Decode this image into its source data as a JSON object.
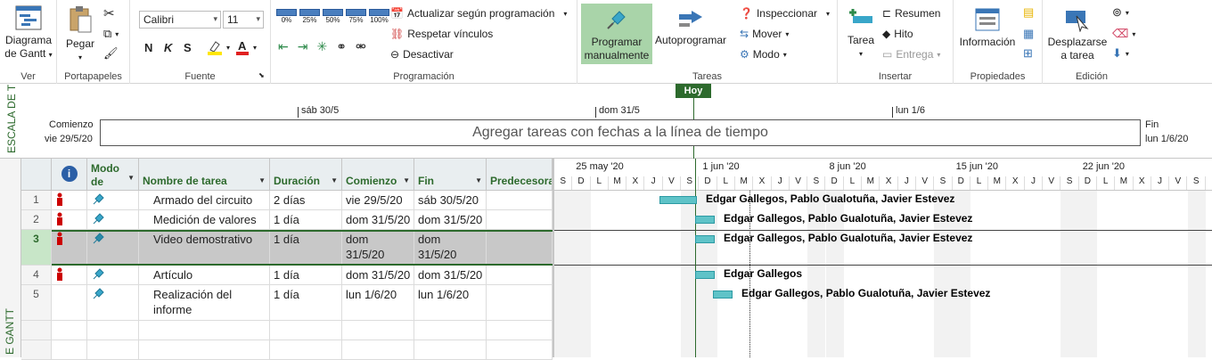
{
  "ribbon": {
    "ver": {
      "label": "Ver",
      "gantt_line1": "Diagrama",
      "gantt_line2": "de Gantt"
    },
    "portapapeles": {
      "label": "Portapapeles",
      "pegar": "Pegar"
    },
    "fuente": {
      "label": "Fuente",
      "font": "Calibri",
      "size": "11",
      "bold": "N",
      "italic": "K",
      "underline": "S"
    },
    "programacion": {
      "label": "Programación",
      "pcts": [
        "0%",
        "25%",
        "50%",
        "75%",
        "100%"
      ],
      "actualizar": "Actualizar según programación",
      "respetar": "Respetar vínculos",
      "desactivar": "Desactivar"
    },
    "tareas": {
      "label": "Tareas",
      "prog_line1": "Programar",
      "prog_line2": "manualmente",
      "auto": "Autoprogramar",
      "inspeccionar": "Inspeccionar",
      "mover": "Mover",
      "modo": "Modo"
    },
    "insertar": {
      "label": "Insertar",
      "tarea": "Tarea",
      "resumen": "Resumen",
      "hito": "Hito",
      "entrega": "Entrega"
    },
    "propiedades": {
      "label": "Propiedades",
      "informacion": "Información"
    },
    "edicion": {
      "label": "Edición",
      "desp_line1": "Desplazarse",
      "desp_line2": "a tarea"
    }
  },
  "timeline": {
    "side_label": "ESCALA DE T",
    "hoy": "Hoy",
    "start_label": "Comienzo",
    "start_date": "vie 29/5/20",
    "end_label": "Fin",
    "end_date": "lun 1/6/20",
    "marks": [
      "sáb 30/5",
      "dom 31/5",
      "lun 1/6"
    ],
    "placeholder": "Agregar tareas con fechas a la línea de tiempo"
  },
  "table": {
    "side_label": "E GANTT",
    "headers": {
      "info": "i",
      "mode_line1": "Modo",
      "mode_line2": "de",
      "name": "Nombre de tarea",
      "duration": "Duración",
      "start": "Comienzo",
      "end": "Fin",
      "pred": "Predecesoras"
    },
    "rows": [
      {
        "id": "1",
        "name": "Armado del circuito",
        "duration": "2 días",
        "start": "vie 29/5/20",
        "end": "sáb 30/5/20"
      },
      {
        "id": "2",
        "name": "Medición de valores",
        "duration": "1 día",
        "start": "dom 31/5/20",
        "end": "dom 31/5/20"
      },
      {
        "id": "3",
        "name": "Video demostrativo",
        "duration": "1 día",
        "start": "dom 31/5/20",
        "end": "dom 31/5/20"
      },
      {
        "id": "4",
        "name": "Artículo",
        "duration": "1 día",
        "start": "dom 31/5/20",
        "end": "dom 31/5/20"
      },
      {
        "id": "5",
        "name": "Realización del informe",
        "duration": "1 día",
        "start": "lun 1/6/20",
        "end": "lun 1/6/20"
      }
    ]
  },
  "gantt": {
    "weeks": [
      "25 may '20",
      "1 jun '20",
      "8 jun '20",
      "15 jun '20",
      "22 jun '20"
    ],
    "days": [
      "S",
      "D",
      "L",
      "M",
      "X",
      "J",
      "V",
      "S",
      "D",
      "L",
      "M",
      "X",
      "J",
      "V",
      "S",
      "D",
      "L",
      "M",
      "X",
      "J",
      "V",
      "S",
      "D",
      "L",
      "M",
      "X",
      "J",
      "V",
      "S",
      "D",
      "L",
      "M",
      "X",
      "J",
      "V",
      "S"
    ],
    "labels": [
      "Edgar Gallegos, Pablo Gualotuña, Javier Estevez",
      "Edgar Gallegos, Pablo Gualotuña, Javier Estevez",
      "Edgar Gallegos, Pablo Gualotuña, Javier Estevez",
      "Edgar Gallegos",
      "Edgar Gallegos, Pablo Gualotuña, Javier Estevez"
    ]
  },
  "colors": {
    "accent": "#217346",
    "bar": "#5fc3c8",
    "selected": "#c8c8c8",
    "hoy": "#2d6a2d"
  }
}
